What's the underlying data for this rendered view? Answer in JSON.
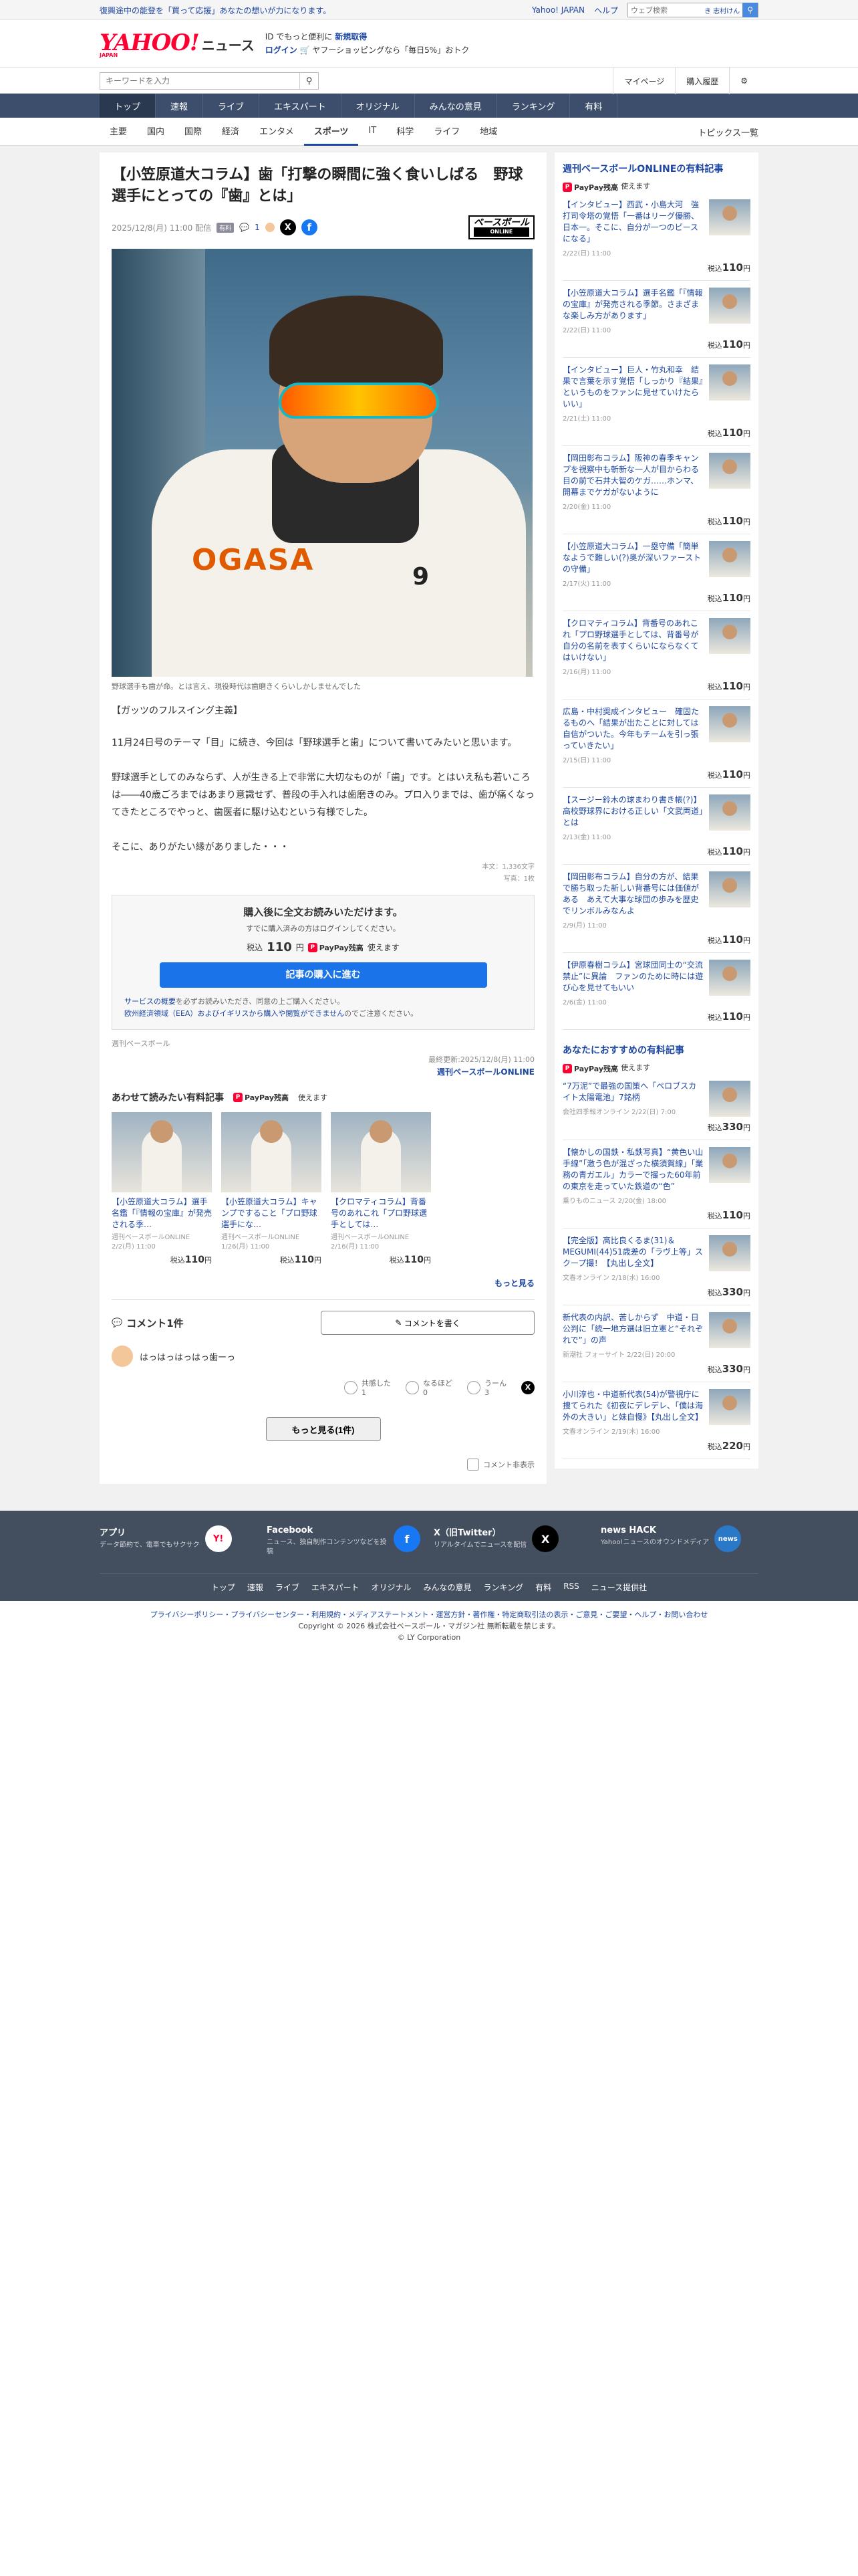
{
  "topbar": {
    "promo": "復興途中の能登を「買って応援」あなたの想いが力になります。",
    "links": [
      "Yahoo! JAPAN",
      "ヘルプ"
    ],
    "search_placeholder": "ウェブ検索",
    "search_mode": "き 志村けん"
  },
  "header": {
    "logo": "YAHOO!",
    "logo_sub": "JAPAN",
    "logo_section": "ニュース",
    "info1": "ID でもっと便利に",
    "info1_link": "新規取得",
    "info2_login": "ログイン",
    "info2": "ヤフーショッピングなら「毎日5%」おトク"
  },
  "searchrow": {
    "placeholder": "キーワードを入力",
    "mypage": "マイページ",
    "purchase_history": "購入履歴"
  },
  "mainnav": [
    "トップ",
    "速報",
    "ライブ",
    "エキスパート",
    "オリジナル",
    "みんなの意見",
    "ランキング",
    "有料"
  ],
  "subnav": [
    "主要",
    "国内",
    "国際",
    "経済",
    "エンタメ",
    "スポーツ",
    "IT",
    "科学",
    "ライフ",
    "地域"
  ],
  "subnav_topics": "トピックス一覧",
  "article": {
    "title": "【小笠原道大コラム】歯「打撃の瞬間に強く食いしばる　野球選手にとっての『歯』とは」",
    "date": "2025/12/8(月) 11:00 配信",
    "badge": "有料",
    "comment_count": "1",
    "brand": "ベースボール",
    "brand_sub": "ONLINE",
    "photo_num": "OGASA",
    "photo_num2": "9",
    "caption": "野球選手も歯が命。とは言え、現役時代は歯磨きくらいしかしませんでした",
    "lead": "【ガッツのフルスイング主義】",
    "para1": "11月24日号のテーマ「目」に続き、今回は「野球選手と歯」について書いてみたいと思います。",
    "para2": "野球選手としてのみならず、人が生きる上で非常に大切なものが「歯」です。とはいえ私も若いころは――40歳ごろまではあまり意識せず、普段の手入れは歯磨きのみ。プロ入りまでは、歯が痛くなってきたところでやっと、歯医者に駆け込むという有様でした。",
    "para3": "そこに、ありがたい縁がありました・・・",
    "stat_chars": "本文：1,336文字",
    "stat_photos": "写真：1枚"
  },
  "buy": {
    "heading": "購入後に全文お読みいただけます。",
    "sub": "すでに購入済みの方はログインしてください。",
    "price_prefix": "税込",
    "price": "110",
    "price_unit": "円",
    "paypay": "PayPay残高",
    "paypay_suffix": "使えます",
    "button": "記事の購入に進む",
    "note_link1": "サービスの概要",
    "note_text1": "を必ずお読みいただき、同意の上ご購入ください。",
    "note_link2": "欧州経済領域（EEA）およびイギリスから購入や閲覧ができません",
    "note_text2": "のでご注意ください。"
  },
  "source": "週刊ベースボール",
  "updated": "最終更新:2025/12/8(月) 11:00",
  "publisher": "週刊ベースボールONLINE",
  "related": {
    "heading": "あわせて読みたい有料記事",
    "paypay": "PayPay残高",
    "paypay_suffix": "使えます",
    "items": [
      {
        "title": "【小笠原道大コラム】選手名鑑「『情報の宝庫』が発売される季…",
        "source": "週刊ベースボールONLINE",
        "date": "2/2(月) 11:00",
        "price_prefix": "税込",
        "price": "110",
        "unit": "円"
      },
      {
        "title": "【小笠原道大コラム】キャンプですること「プロ野球選手にな…",
        "source": "週刊ベースボールONLINE",
        "date": "1/26(月) 11:00",
        "price_prefix": "税込",
        "price": "110",
        "unit": "円"
      },
      {
        "title": "【クロマティコラム】背番号のあれこれ「プロ野球選手としては…",
        "source": "週刊ベースボールONLINE",
        "date": "2/16(月) 11:00",
        "price_prefix": "税込",
        "price": "110",
        "unit": "円"
      }
    ],
    "more": "もっと見る"
  },
  "comments": {
    "heading": "コメント1件",
    "write": "コメントを書く",
    "text": "はっはっはっはっ歯ーっ",
    "reactions": [
      {
        "label": "共感した",
        "count": "1"
      },
      {
        "label": "なるほど",
        "count": "0"
      },
      {
        "label": "うーん",
        "count": "3"
      }
    ],
    "more": "もっと見る(1件)",
    "hide": "コメント非表示"
  },
  "sidebar1": {
    "heading": "週刊ベースボールONLINEの有料記事",
    "paypay": "PayPay残高",
    "paypay_suffix": "使えます",
    "items": [
      {
        "title": "【インタビュー】西武・小島大河　強打司令塔の覚悟「一番はリーグ優勝、日本一。そこに、自分が一つのピースになる」",
        "date": "2/22(日) 11:00",
        "price_prefix": "税込",
        "price": "110",
        "unit": "円"
      },
      {
        "title": "【小笠原道大コラム】選手名鑑「『情報の宝庫』が発売される季節。さまざまな楽しみ方があります」",
        "date": "2/22(日) 11:00",
        "price_prefix": "税込",
        "price": "110",
        "unit": "円"
      },
      {
        "title": "【インタビュー】巨人・竹丸和幸　結果で言葉を示す覚悟「しっかり『結果』というものをファンに見せていけたらいい」",
        "date": "2/21(土) 11:00",
        "price_prefix": "税込",
        "price": "110",
        "unit": "円"
      },
      {
        "title": "【岡田彰布コラム】阪神の春季キャンプを視察中も斬新な一人が目からわる目の前で石井大智のケガ……ホンマ、開幕までケガがないように",
        "date": "2/20(金) 11:00",
        "price_prefix": "税込",
        "price": "110",
        "unit": "円"
      },
      {
        "title": "【小笠原道大コラム】一塁守備「簡単なようで難しい(?)奥が深いファーストの守備」",
        "date": "2/17(火) 11:00",
        "price_prefix": "税込",
        "price": "110",
        "unit": "円"
      },
      {
        "title": "【クロマティコラム】背番号のあれこれ「プロ野球選手としては、背番号が自分の名前を表すくらいにならなくてはいけない」",
        "date": "2/16(月) 11:00",
        "price_prefix": "税込",
        "price": "110",
        "unit": "円"
      },
      {
        "title": "広島・中村奨成インタビュー　確固たるものへ「結果が出たことに対しては自信がついた。今年もチームを引っ張っていきたい」",
        "date": "2/15(日) 11:00",
        "price_prefix": "税込",
        "price": "110",
        "unit": "円"
      },
      {
        "title": "【スージー鈴木の球まわり書き帳(?)】高校野球界における正しい「文武両道」とは",
        "date": "2/13(金) 11:00",
        "price_prefix": "税込",
        "price": "110",
        "unit": "円"
      },
      {
        "title": "【岡田彰布コラム】自分の方が、結果で勝ち取った新しい背番号には価値がある　あえて大事な球団の歩みを歴史でリンボルみなんよ",
        "date": "2/9(月) 11:00",
        "price_prefix": "税込",
        "price": "110",
        "unit": "円"
      },
      {
        "title": "【伊原春樹コラム】宮球団同士の“交流禁止”に異論　ファンのために時には遊び心を見せてもいい",
        "date": "2/6(金) 11:00",
        "price_prefix": "税込",
        "price": "110",
        "unit": "円"
      }
    ]
  },
  "sidebar2": {
    "heading": "あなたにおすすめの有料記事",
    "paypay": "PayPay残高",
    "paypay_suffix": "使えます",
    "items": [
      {
        "title": "“7万泥”で最強の国策へ「ペロブスカイト太陽電池」7銘柄",
        "date": "会社四季報オンライン 2/22(日) 7:00",
        "price_prefix": "税込",
        "price": "330",
        "unit": "円"
      },
      {
        "title": "【懐かしの国鉄・私鉄写真】“黄色い山手線”「激う色が混ざった横須賀線」「業務の青ガエル」カラーで撮った60年前の東京を走っていた鉄道の“色”",
        "date": "乗りものニュース 2/20(金) 18:00",
        "price_prefix": "税込",
        "price": "110",
        "unit": "円"
      },
      {
        "title": "【完全版】高比良くるま(31)＆MEGUMI(44)51歳差の「ラヴ上等」スクープ撮！【丸出し全文】",
        "date": "文春オンライン 2/18(水) 16:00",
        "price_prefix": "税込",
        "price": "330",
        "unit": "円"
      },
      {
        "title": "新代表の内訳、苦しからず　中道・日公判に「統一地方選は旧立憲と“それぞれで”」の声",
        "date": "新潮社 フォーサイト 2/22(日) 20:00",
        "price_prefix": "税込",
        "price": "330",
        "unit": "円"
      },
      {
        "title": "小川淳也・中道新代表(54)が警視庁に捜てられた《初夜にデレデレ、「僕は海外の大きい」と妹自慢》【丸出し全文】",
        "date": "文春オンライン 2/19(木) 16:00",
        "price_prefix": "税込",
        "price": "220",
        "unit": "円"
      }
    ]
  },
  "footer": {
    "apps": [
      {
        "name": "アプリ",
        "desc": "データ節約で、電車でもサクサク",
        "icon": "Y!"
      },
      {
        "name": "Facebook",
        "desc": "ニュース、独自制作コンテンツなどを投稿",
        "icon": "f"
      },
      {
        "name": "X（旧Twitter）",
        "desc": "リアルタイムでニュースを配信",
        "icon": "X"
      },
      {
        "name": "news HACK",
        "desc": "Yahoo!ニュースのオウンドメディア",
        "icon": "news"
      }
    ],
    "nav": [
      "トップ",
      "速報",
      "ライブ",
      "エキスパート",
      "オリジナル",
      "みんなの意見",
      "ランキング",
      "有料",
      "RSS",
      "ニュース提供社"
    ],
    "legal1": "プライバシーポリシー・プライバシーセンター・利用規約・メディアステートメント・運営方針・著作権・特定商取引法の表示・ご意見・ご要望・ヘルプ・お問い合わせ",
    "legal2": "Copyright © 2026 株式会社ベースボール・マガジン社 無断転載を禁じます。",
    "legal3": "© LY Corporation"
  }
}
